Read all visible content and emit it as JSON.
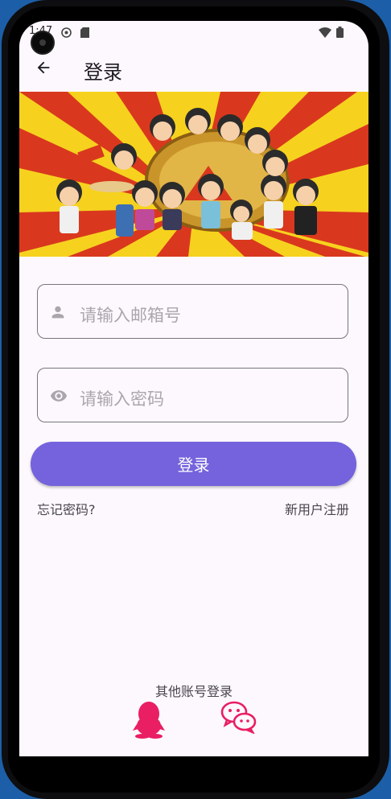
{
  "status_bar": {
    "time": "1:47"
  },
  "app_bar": {
    "title": "登录",
    "back_icon": "arrow-back-icon"
  },
  "form": {
    "email": {
      "placeholder": "请输入邮箱号",
      "icon": "person-icon"
    },
    "password": {
      "placeholder": "请输入密码",
      "icon": "eye-icon"
    },
    "login_label": "登录",
    "forgot_label": "忘记密码?",
    "register_label": "新用户注册"
  },
  "social": {
    "label": "其他账号登录",
    "items": [
      {
        "icon": "qq-icon",
        "color": "#e91e63"
      },
      {
        "icon": "wechat-icon",
        "color": "#e91e63"
      }
    ]
  },
  "colors": {
    "accent": "#7463dc",
    "background": "#fdf8fd",
    "social": "#e91e63"
  }
}
